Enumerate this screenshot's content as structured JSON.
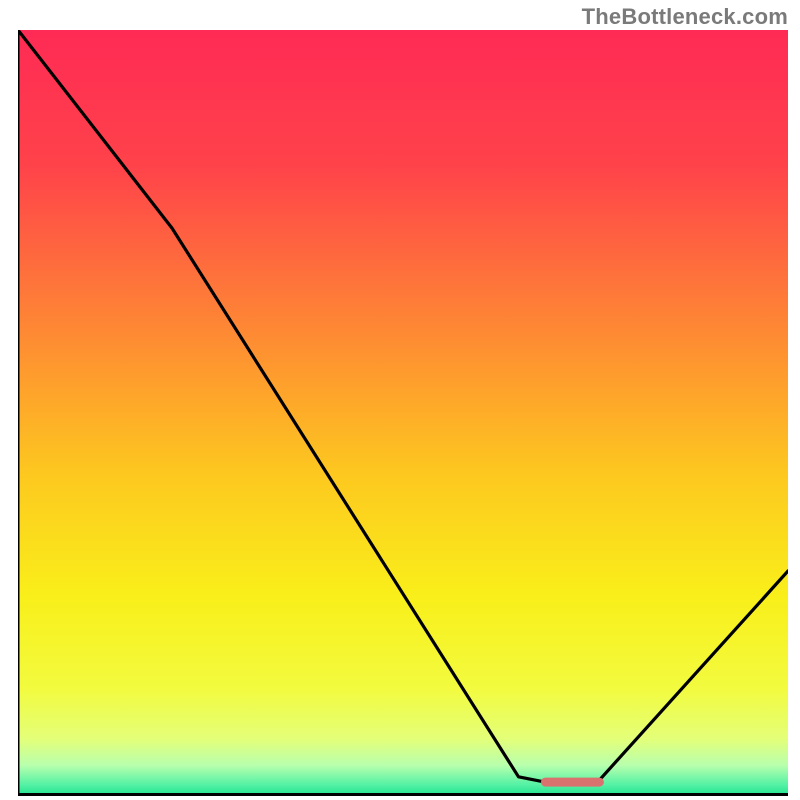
{
  "watermark": "TheBottleneck.com",
  "chart_data": {
    "type": "line",
    "title": "",
    "xlabel": "",
    "ylabel": "",
    "xlim": [
      0,
      100
    ],
    "ylim": [
      0,
      100
    ],
    "x": [
      0,
      20,
      65,
      70,
      75,
      100
    ],
    "values": [
      100,
      74,
      2,
      1,
      1,
      29
    ],
    "gradient_stops": [
      {
        "offset": 0.0,
        "color": "#ff2a55"
      },
      {
        "offset": 0.18,
        "color": "#ff434a"
      },
      {
        "offset": 0.4,
        "color": "#fe8b33"
      },
      {
        "offset": 0.58,
        "color": "#fdc81f"
      },
      {
        "offset": 0.74,
        "color": "#f9ef1a"
      },
      {
        "offset": 0.86,
        "color": "#f2fb3f"
      },
      {
        "offset": 0.925,
        "color": "#e4ff78"
      },
      {
        "offset": 0.96,
        "color": "#b8ffad"
      },
      {
        "offset": 0.985,
        "color": "#56f2a5"
      },
      {
        "offset": 1.0,
        "color": "#1ee28d"
      }
    ],
    "optimal_marker": {
      "x": 72,
      "y": 1.3,
      "length": 7,
      "color": "#d9716f"
    },
    "axis_color": "#000000"
  }
}
